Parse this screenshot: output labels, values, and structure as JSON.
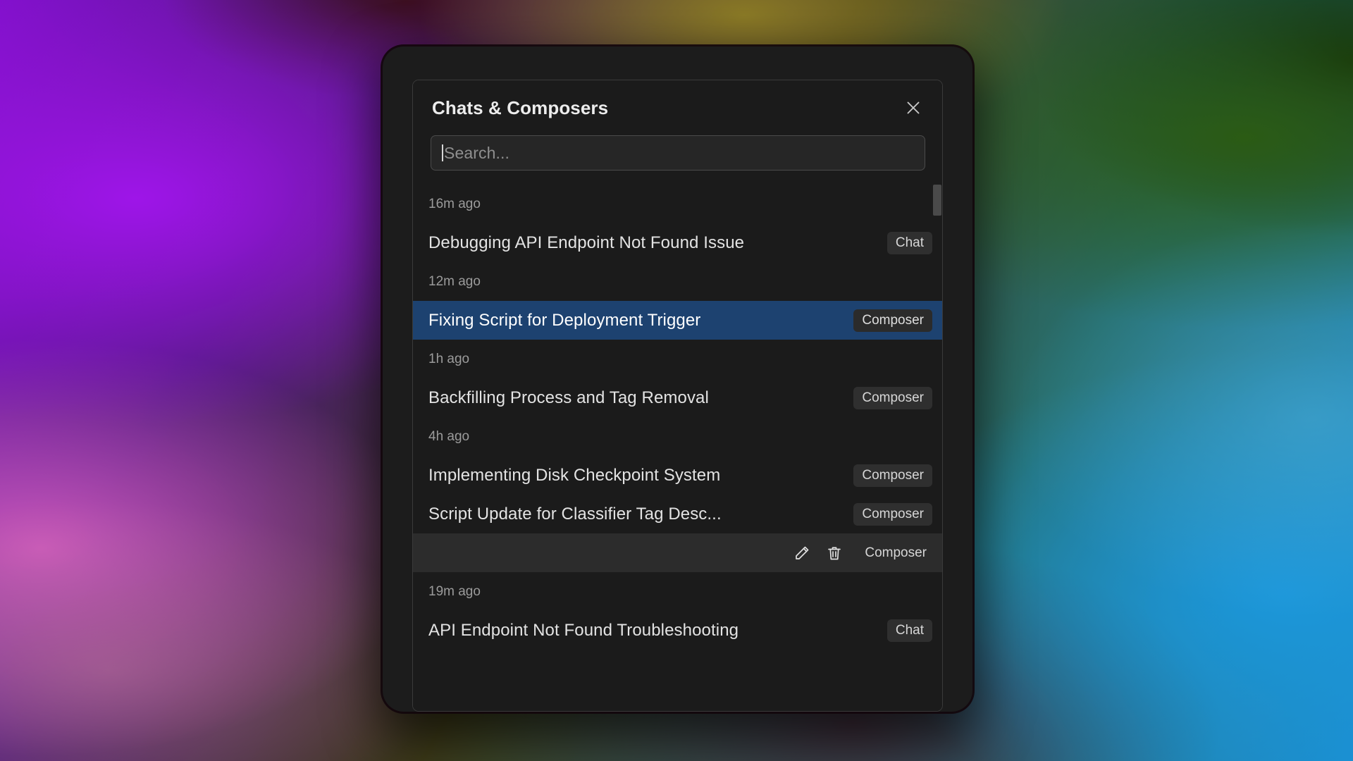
{
  "window": {
    "title": "Chats & Composers",
    "close_icon": "close-icon"
  },
  "search": {
    "placeholder": "Search...",
    "value": ""
  },
  "list": [
    {
      "group": "16m ago",
      "rows": [
        {
          "title": "Debugging API Endpoint Not Found Issue",
          "badge": "Chat",
          "state": "normal"
        }
      ]
    },
    {
      "group": "12m ago",
      "rows": [
        {
          "title": "Fixing Script for Deployment Trigger",
          "badge": "Composer",
          "state": "selected"
        }
      ]
    },
    {
      "group": "1h ago",
      "rows": [
        {
          "title": "Backfilling Process and Tag Removal",
          "badge": "Composer",
          "state": "normal"
        }
      ]
    },
    {
      "group": "4h ago",
      "rows": [
        {
          "title": "Implementing Disk Checkpoint System",
          "badge": "Composer",
          "state": "normal"
        },
        {
          "title": "Script Update for Classifier Tag Desc...",
          "badge": "Composer",
          "state": "normal"
        },
        {
          "title": "",
          "badge": "Composer",
          "state": "hovered",
          "actions": [
            "edit-icon",
            "trash-icon"
          ]
        }
      ]
    },
    {
      "group": "19m ago",
      "rows": [
        {
          "title": "API Endpoint Not Found Troubleshooting",
          "badge": "Chat",
          "state": "normal"
        }
      ]
    }
  ],
  "colors": {
    "panel_bg": "#1b1b1b",
    "window_bg": "#1c1c1c",
    "selected_row": "#1d4270",
    "hovered_row": "#2c2c2c",
    "badge_bg": "#2f2f2f",
    "text_primary": "#e3e3e3",
    "text_muted": "#9b9b9b",
    "border": "#3a3a3a",
    "scrollbar_thumb": "#4a4a4a"
  }
}
